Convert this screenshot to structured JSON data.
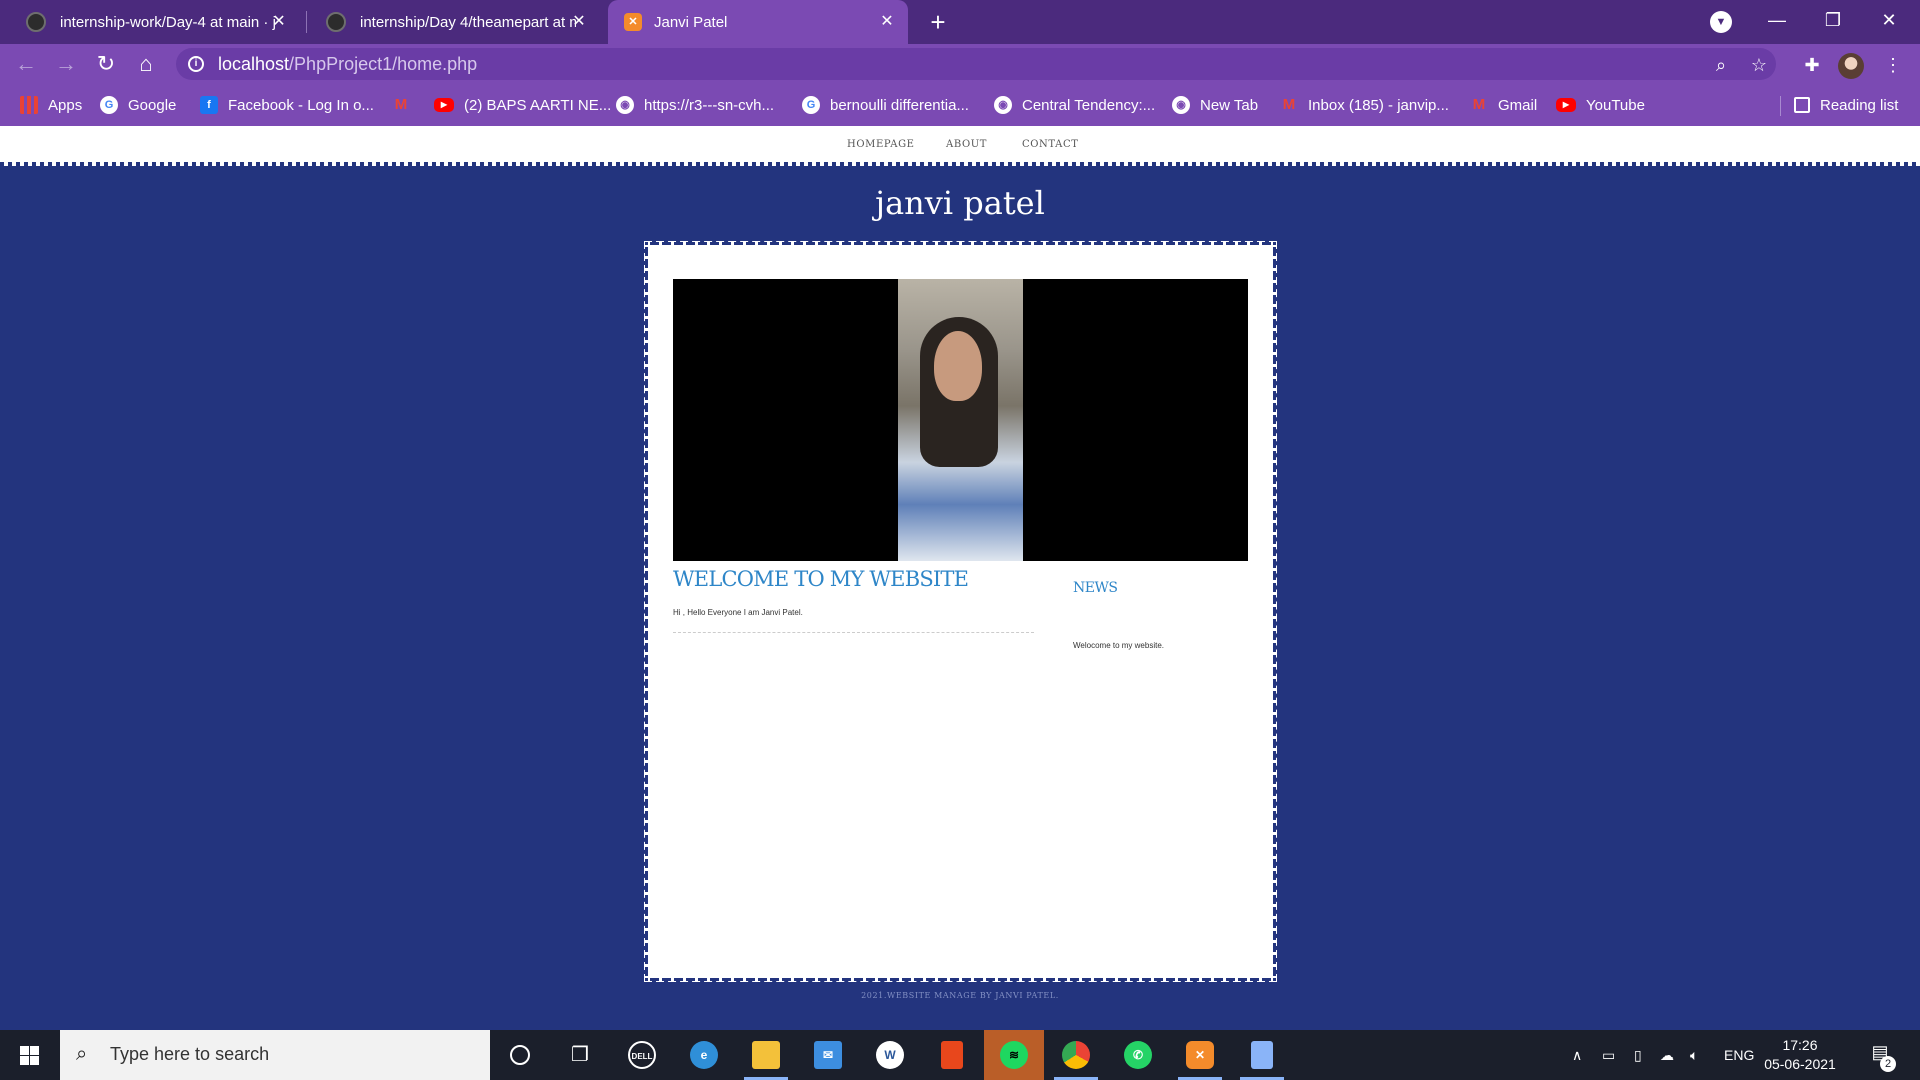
{
  "browser": {
    "tabs": [
      {
        "title": "internship-work/Day-4 at main · j",
        "active": false
      },
      {
        "title": "internship/Day 4/theamepart at m",
        "active": false
      },
      {
        "title": "Janvi Patel",
        "active": true
      }
    ],
    "new_tab_symbol": "+",
    "url_host": "localhost",
    "url_path": "/PhpProject1/home.php",
    "bookmarks": [
      {
        "label": "Apps",
        "icon": "apps-grid-icon"
      },
      {
        "label": "Google",
        "icon": "google-icon"
      },
      {
        "label": "Facebook - Log In o...",
        "icon": "facebook-icon"
      },
      {
        "label": "",
        "icon": "gmail-icon"
      },
      {
        "label": "(2) BAPS AARTI NE...",
        "icon": "youtube-icon"
      },
      {
        "label": "https://r3---sn-cvh...",
        "icon": "globe-icon"
      },
      {
        "label": "bernoulli differentia...",
        "icon": "google-icon"
      },
      {
        "label": "Central Tendency:...",
        "icon": "globe-icon"
      },
      {
        "label": "New Tab",
        "icon": "globe-icon"
      },
      {
        "label": "Inbox (185) - janvip...",
        "icon": "gmail-icon"
      },
      {
        "label": "Gmail",
        "icon": "gmail-icon"
      },
      {
        "label": "YouTube",
        "icon": "youtube-icon"
      }
    ],
    "reading_list": "Reading list"
  },
  "site": {
    "nav": [
      "HOMEPAGE",
      "ABOUT",
      "CONTACT"
    ],
    "title": "janvi patel",
    "welcome_heading": "WELCOME TO MY WEBSITE",
    "intro_text": "Hi , Hello Everyone I am Janvi Patel.",
    "news_heading": "NEWS",
    "news_text": "Welocome to my website.",
    "footer": "2021.WEBSITE MANAGE BY JANVI PATEL."
  },
  "taskbar": {
    "search_placeholder": "Type here to search",
    "language": "ENG",
    "time": "17:26",
    "date": "05-06-2021",
    "notification_count": "2"
  },
  "colors": {
    "tab_strip": "#4b2a7d",
    "toolbar": "#7b4ab3",
    "page_background": "#23347e",
    "heading_blue": "#2e86c8"
  }
}
